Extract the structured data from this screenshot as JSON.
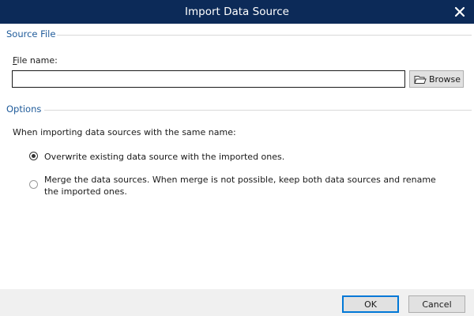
{
  "window": {
    "title": "Import Data Source",
    "close_icon": "close-icon"
  },
  "source_file": {
    "heading": "Source File",
    "file_name_label": "File name:",
    "file_name_value": "",
    "browse_label": "Browse",
    "browse_icon": "folder-icon"
  },
  "options": {
    "heading": "Options",
    "prompt": "When importing data sources with the same name:",
    "choices": [
      {
        "label": "Overwrite existing data source with the imported ones.",
        "selected": true
      },
      {
        "label": "Merge the data sources. When merge is not possible, keep both data sources and rename the imported ones.",
        "selected": false
      }
    ]
  },
  "footer": {
    "ok_label": "OK",
    "cancel_label": "Cancel"
  },
  "colors": {
    "titlebar": "#0c2a58",
    "section_heading": "#1f5b9a",
    "default_button_border": "#0078d7"
  }
}
